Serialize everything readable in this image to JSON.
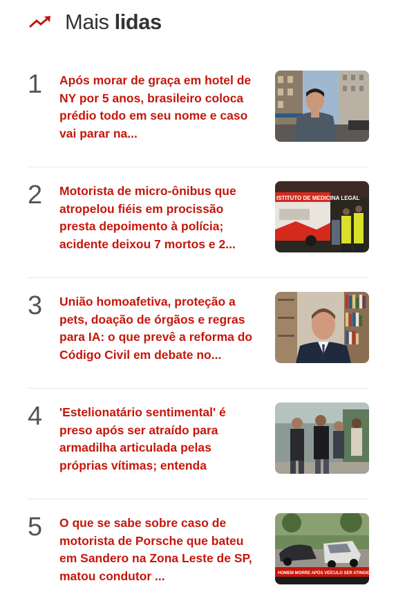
{
  "header": {
    "icon": "trending-up-icon",
    "title_light": "Mais",
    "title_bold": "lidas",
    "accent_color": "#c4170c"
  },
  "items": [
    {
      "rank": "1",
      "headline": "Após morar de graça em hotel de NY por 5 anos, brasileiro coloca prédio todo em seu nome e caso vai parar na...",
      "thumbnail": "man-in-front-of-new-york-hotel-image"
    },
    {
      "rank": "2",
      "headline": "Motorista de micro-ônibus que atropelou fiéis em procissão presta depoimento à polícia; acidente deixou 7 mortos e 2...",
      "thumbnail": "ambulance-and-police-at-night-image",
      "thumbnail_text": "ISTITUTO DE MEDICINA LEGAL"
    },
    {
      "rank": "3",
      "headline": "União homoafetiva, proteção a pets, doação de órgãos e regras para IA: o que prevê a reforma do Código Civil em debate no...",
      "thumbnail": "man-in-suit-in-front-of-bookshelf-image"
    },
    {
      "rank": "4",
      "headline": "'Estelionatário sentimental' é preso após ser atraído para armadilha articulada pelas próprias vítimas; entenda",
      "thumbnail": "police-escorting-suspect-image"
    },
    {
      "rank": "5",
      "headline": "O que se sabe sobre caso de motorista de Porsche que bateu em Sandero na Zona Leste de SP, matou condutor ...",
      "thumbnail": "wrecked-cars-news-broadcast-image",
      "thumbnail_text": "HOMEM MORRE APÓS VEÍCULO SER ATINGIDO POR CARRO DE LUXO"
    }
  ]
}
